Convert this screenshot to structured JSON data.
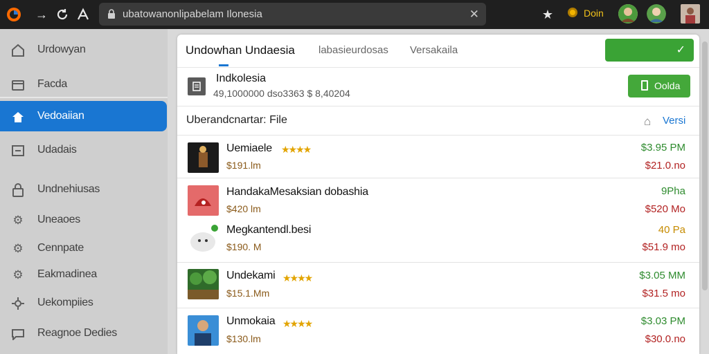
{
  "browser": {
    "url": "ubatowanonlipabelam Ilonesia",
    "coin_label": "Doin"
  },
  "sidebar": {
    "items": [
      {
        "label": "Urdowyan",
        "icon": "home-outline-icon"
      },
      {
        "label": "Facda",
        "icon": "folder-icon"
      },
      {
        "label": "Vedoaiian",
        "icon": "home-icon"
      },
      {
        "label": "Udadais",
        "icon": "document-icon"
      },
      {
        "label": "Undnehiusas",
        "icon": "lock-icon"
      },
      {
        "label": "Uneaoes",
        "icon": "gear-icon"
      },
      {
        "label": "Cennpate",
        "icon": "gear-icon"
      },
      {
        "label": "Eakmadinea",
        "icon": "gear-icon"
      },
      {
        "label": "Uekompiies",
        "icon": "settings-icon"
      },
      {
        "label": "Reagnoe Dedies",
        "icon": "chat-icon"
      }
    ]
  },
  "tabs": [
    {
      "label": "Undowhan Undaesia"
    },
    {
      "label": "labasieurdosas"
    },
    {
      "label": "Versakaila"
    }
  ],
  "info": {
    "title": "Indkolesia",
    "subtitle": "49,1000000 dso3363 $ 8,40204",
    "button": "Oolda"
  },
  "file_header": {
    "label": "Uberandcnartar: File",
    "versi": "Versi"
  },
  "rows": [
    {
      "name": "Uemiaele",
      "price": "$191.lm",
      "green": "$3.95 PM",
      "red": "$21.0.no"
    },
    {
      "name": "HandakaMesaksian dobashia",
      "price": "$420 lm",
      "green": "9Pha",
      "red": "$520 Mo"
    },
    {
      "name": "Megkantendl.besi",
      "price": "$190. M",
      "yellow": "40 Pa",
      "red": "$51.9 mo"
    },
    {
      "name": "Undekami",
      "price": "$15.1.Mm",
      "green": "$3.05 MM",
      "red": "$31.5 mo"
    },
    {
      "name": "Unmokaia",
      "price": "$130.lm",
      "green": "$3.03 PM",
      "red": "$30.0.no"
    }
  ]
}
